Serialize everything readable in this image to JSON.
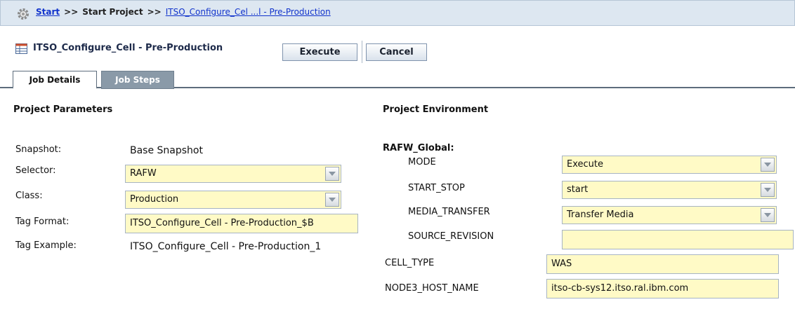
{
  "breadcrumb": {
    "start": "Start",
    "separator": ">>",
    "middle": "Start Project",
    "current": "ITSO_Configure_Cel ...l - Pre-Production"
  },
  "header": {
    "job_title": "ITSO_Configure_Cell - Pre-Production",
    "execute_label": "Execute",
    "cancel_label": "Cancel"
  },
  "tabs": [
    {
      "label": "Job Details",
      "active": true
    },
    {
      "label": "Job Steps",
      "active": false
    }
  ],
  "project_parameters": {
    "heading": "Project Parameters",
    "snapshot": {
      "label": "Snapshot:",
      "value": "Base Snapshot"
    },
    "selector": {
      "label": "Selector:",
      "value": "RAFW"
    },
    "class": {
      "label": "Class:",
      "value": "Production"
    },
    "tag_format": {
      "label": "Tag Format:",
      "value": "ITSO_Configure_Cell - Pre-Production_$B"
    },
    "tag_example": {
      "label": "Tag Example:",
      "value": "ITSO_Configure_Cell - Pre-Production_1"
    }
  },
  "project_environment": {
    "heading": "Project Environment",
    "group": "RAFW_Global:",
    "mode": {
      "label": "MODE",
      "value": "Execute"
    },
    "start_stop": {
      "label": "START_STOP",
      "value": "start"
    },
    "media_transfer": {
      "label": "MEDIA_TRANSFER",
      "value": "Transfer Media"
    },
    "source_revision": {
      "label": "SOURCE_REVISION",
      "value": ""
    },
    "cell_type": {
      "label": "CELL_TYPE",
      "value": "WAS"
    },
    "node3_host_name": {
      "label": "NODE3_HOST_NAME",
      "value": "itso-cb-sys12.itso.ral.ibm.com"
    }
  },
  "colors": {
    "field_background": "#fffac6",
    "breadcrumb_background": "#dde7f1",
    "link": "#1133cc",
    "inactive_tab": "#8a9aa8"
  }
}
